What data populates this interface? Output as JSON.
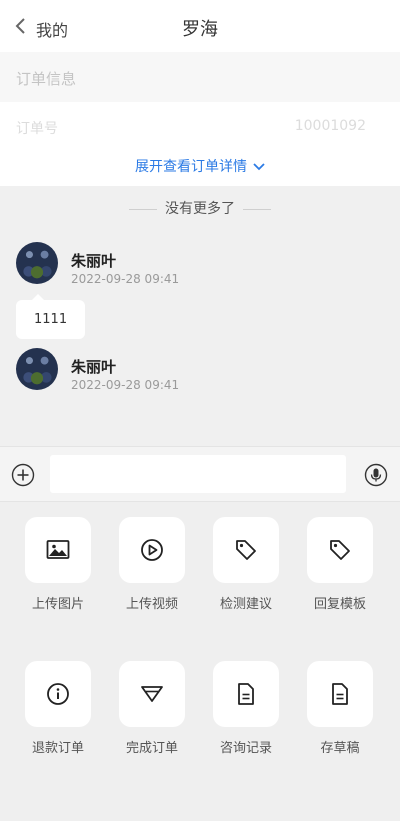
{
  "nav": {
    "back_label": "我的",
    "title": "罗海"
  },
  "order": {
    "header": "订单信息",
    "row_label": "订单号",
    "row_value": "10001092",
    "expand_label": "展开查看订单详情"
  },
  "chat": {
    "no_more": "没有更多了",
    "messages": [
      {
        "name": "朱丽叶",
        "time": "2022-09-28 09:41",
        "text": "1111"
      },
      {
        "name": "朱丽叶",
        "time": "2022-09-28 09:41"
      }
    ]
  },
  "input": {
    "placeholder": ""
  },
  "tools": [
    {
      "label": "上传图片",
      "icon": "image-icon"
    },
    {
      "label": "上传视频",
      "icon": "video-icon"
    },
    {
      "label": "检测建议",
      "icon": "tag-icon"
    },
    {
      "label": "回复模板",
      "icon": "tag-icon"
    },
    {
      "label": "退款订单",
      "icon": "info-icon"
    },
    {
      "label": "完成订单",
      "icon": "diamond-icon"
    },
    {
      "label": "咨询记录",
      "icon": "document-icon"
    },
    {
      "label": "存草稿",
      "icon": "document-icon"
    }
  ]
}
